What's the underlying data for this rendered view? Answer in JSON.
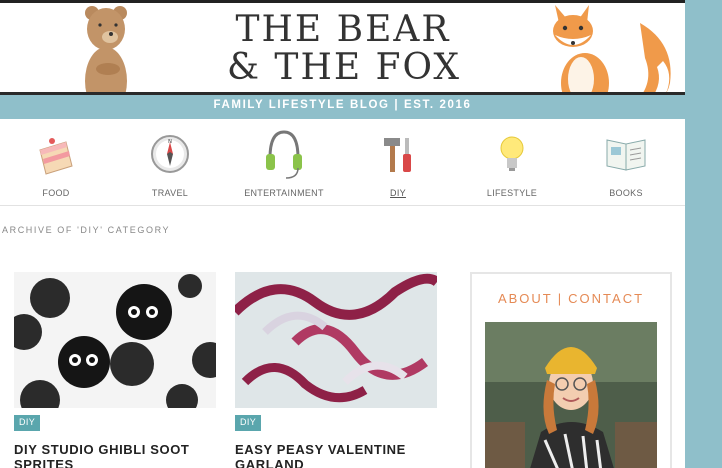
{
  "header": {
    "title_line1": "THE BEAR",
    "title_line2": "& THE FOX",
    "tagline": "FAMILY LIFESTYLE BLOG | EST. 2016"
  },
  "nav": {
    "items": [
      {
        "label": "FOOD",
        "icon": "cake-icon"
      },
      {
        "label": "TRAVEL",
        "icon": "compass-icon"
      },
      {
        "label": "ENTERTAINMENT",
        "icon": "headphones-icon"
      },
      {
        "label": "DIY",
        "icon": "tools-icon"
      },
      {
        "label": "LIFESTYLE",
        "icon": "lightbulb-icon"
      },
      {
        "label": "BOOKS",
        "icon": "book-icon"
      }
    ],
    "active": "DIY"
  },
  "archive_label": "ARCHIVE OF 'DIY' CATEGORY",
  "posts": [
    {
      "tag": "DIY",
      "title_line1": "DIY STUDIO GHIBLI SOOT",
      "title_line2": "SPRITES"
    },
    {
      "tag": "DIY",
      "title_line1": "EASY PEASY VALENTINE",
      "title_line2": "GARLAND"
    }
  ],
  "sidebar": {
    "about": "ABOUT",
    "separator": "|",
    "contact": "CONTACT"
  },
  "colors": {
    "accent_teal": "#8fbfca",
    "tag_teal": "#5aa6ad",
    "orange": "#e58a55"
  }
}
